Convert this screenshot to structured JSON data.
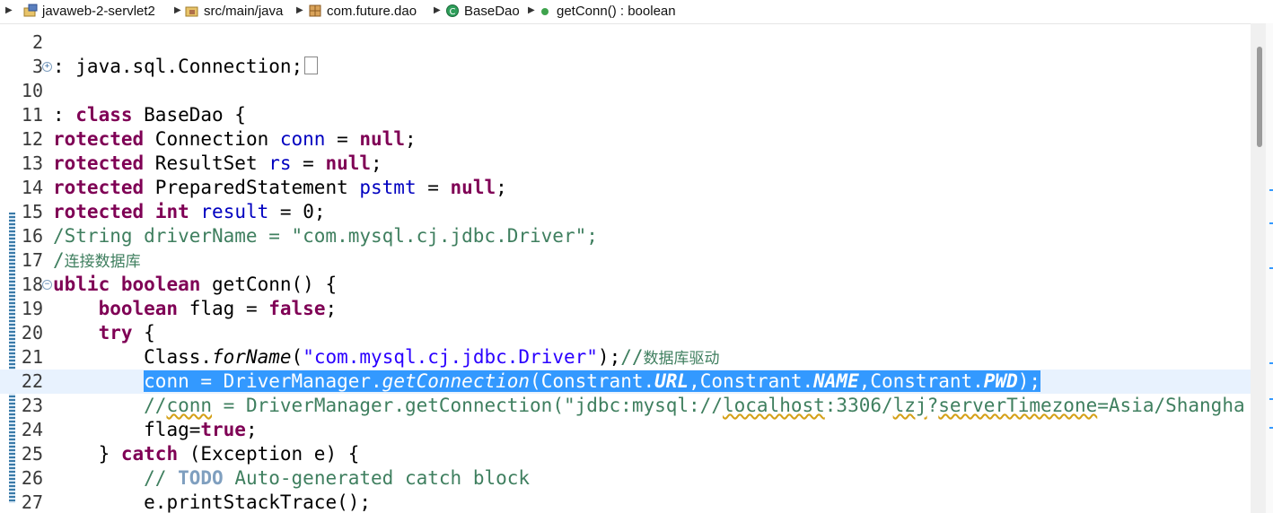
{
  "breadcrumb": {
    "project": "javaweb-2-servlet2",
    "folder": "src/main/java",
    "package": "com.future.dao",
    "class": "BaseDao",
    "method": "getConn() : boolean"
  },
  "lines": [
    {
      "n": "2"
    },
    {
      "n": "3",
      "fold": "+"
    },
    {
      "n": "10"
    },
    {
      "n": "11"
    },
    {
      "n": "12"
    },
    {
      "n": "13"
    },
    {
      "n": "14"
    },
    {
      "n": "15"
    },
    {
      "n": "16"
    },
    {
      "n": "17"
    },
    {
      "n": "18",
      "fold": "−"
    },
    {
      "n": "19"
    },
    {
      "n": "20"
    },
    {
      "n": "21"
    },
    {
      "n": "22"
    },
    {
      "n": "23"
    },
    {
      "n": "24"
    },
    {
      "n": "25"
    },
    {
      "n": "26"
    },
    {
      "n": "27"
    }
  ],
  "tokens": {
    "l3_a": ": java.sql.Connection;",
    "l11_a": ": ",
    "l11_kw": "class",
    "l11_b": " BaseDao {",
    "l12_a": "rotected",
    "l12_b": " Connection ",
    "l12_f": "conn",
    "l12_c": " = ",
    "l12_kw": "null",
    "l12_d": ";",
    "l13_a": "rotected",
    "l13_b": " ResultSet ",
    "l13_f": "rs",
    "l13_c": " = ",
    "l13_kw": "null",
    "l13_d": ";",
    "l14_a": "rotected",
    "l14_b": " PreparedStatement ",
    "l14_f": "pstmt",
    "l14_c": " = ",
    "l14_kw": "null",
    "l14_d": ";",
    "l15_a": "rotected",
    "l15_b": " ",
    "l15_kw": "int",
    "l15_c": " ",
    "l15_f": "result",
    "l15_d": " = 0;",
    "l16_cmt": "/String driverName = \"com.mysql.cj.jdbc.Driver\";",
    "l17_cmt": "/",
    "l17_cjk": "连接数据库",
    "l18_a": "ublic",
    "l18_b": " ",
    "l18_kw": "boolean",
    "l18_c": " getConn() {",
    "l19_i": "    ",
    "l19_kw": "boolean",
    "l19_b": " flag = ",
    "l19_kw2": "false",
    "l19_c": ";",
    "l20_i": "    ",
    "l20_kw": "try",
    "l20_b": " {",
    "l21_i": "        ",
    "l21_a": "Class.",
    "l21_it": "forName",
    "l21_b": "(",
    "l21_str": "\"com.mysql.cj.jdbc.Driver\"",
    "l21_c": ");",
    "l21_cmt": "//",
    "l21_cjk": "数据库驱动",
    "l22_i": "        ",
    "l22_a": "conn = DriverManager.",
    "l22_it": "getConnection",
    "l22_b": "(Constrant.",
    "l22_f1": "URL",
    "l22_c": ",Constrant.",
    "l22_f2": "NAME",
    "l22_d": ",Constrant.",
    "l22_f3": "PWD",
    "l22_e": ");",
    "l23_i": "        ",
    "l23_a": "//",
    "l23_sq1": "conn",
    "l23_b": " = DriverManager.getConnection(\"jdbc:mysql://",
    "l23_sq2": "localhost",
    "l23_c": ":3306/",
    "l23_sq3": "lzj",
    "l23_d": "?",
    "l23_sq4": "serverTimezone",
    "l23_e": "=Asia/Shangha",
    "l24_i": "        ",
    "l24_a": "flag=",
    "l24_kw": "true",
    "l24_b": ";",
    "l25_i": "    ",
    "l25_a": "} ",
    "l25_kw": "catch",
    "l25_b": " (Exception e) {",
    "l26_i": "        ",
    "l26_a": "// ",
    "l26_todo": "TODO",
    "l26_b": " Auto-generated catch block",
    "l27_i": "        ",
    "l27_a": "e.printStackTrace();"
  },
  "colors": {
    "keyword": "#7f0055",
    "field": "#0000c0",
    "string": "#2a00ff",
    "comment": "#3f7f5f",
    "selection": "#3399ff"
  }
}
